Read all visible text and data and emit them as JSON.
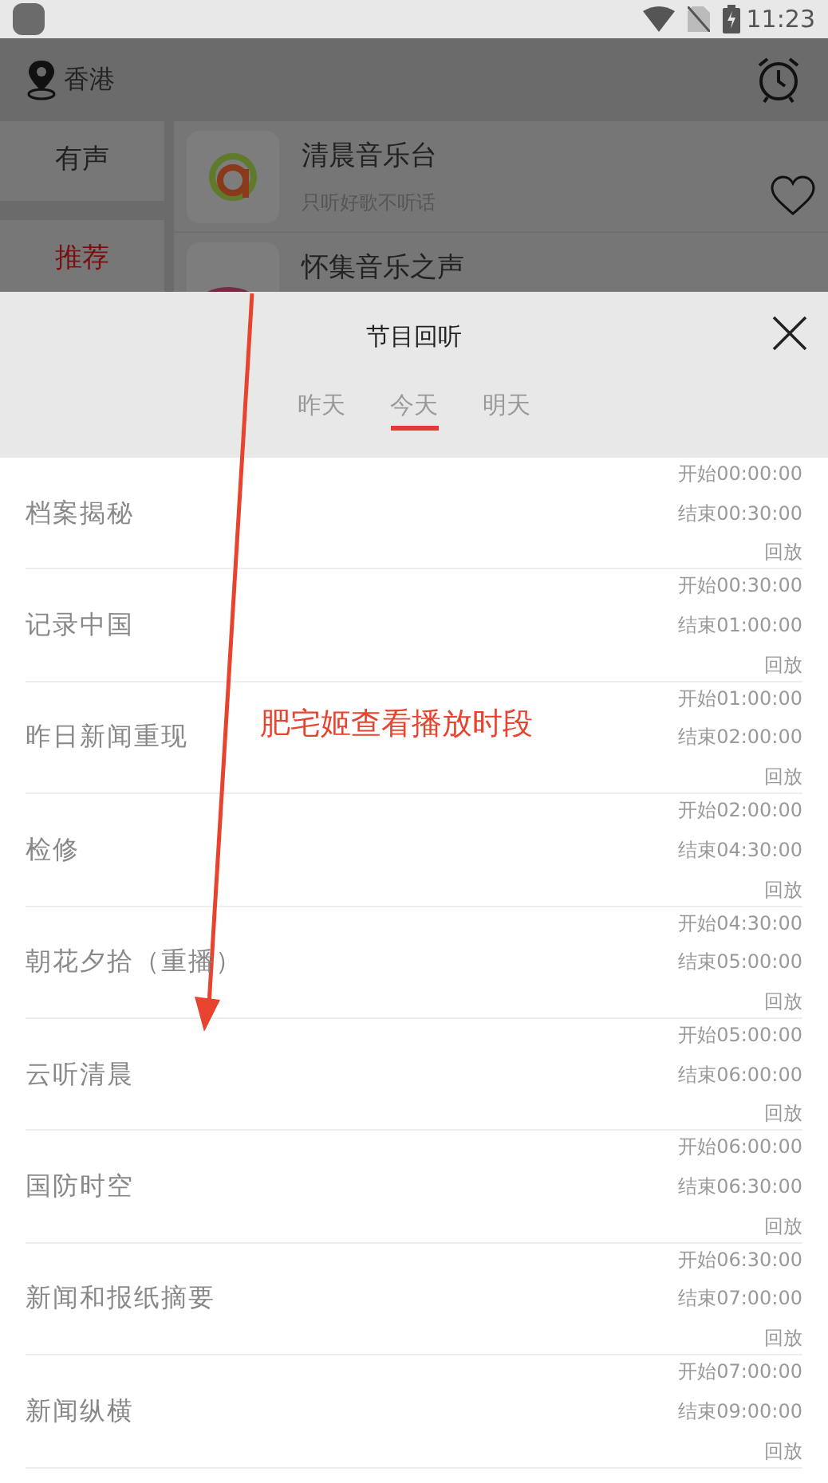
{
  "status_bar": {
    "time": "11:23"
  },
  "header": {
    "location": "香港"
  },
  "categories": [
    {
      "label": "有声",
      "selected": false
    },
    {
      "label": "推荐",
      "selected": true
    }
  ],
  "stations": [
    {
      "name": "清晨音乐台",
      "slogan": "只听好歌不听话"
    },
    {
      "name": "怀集音乐之声"
    }
  ],
  "sheet": {
    "title": "节目回听",
    "tabs": [
      {
        "label": "昨天",
        "selected": false
      },
      {
        "label": "今天",
        "selected": true
      },
      {
        "label": "明天",
        "selected": false
      }
    ],
    "programs": [
      {
        "title": "档案揭秘",
        "start": "开始00:00:00",
        "end": "结束00:30:00",
        "action": "回放"
      },
      {
        "title": "记录中国",
        "start": "开始00:30:00",
        "end": "结束01:00:00",
        "action": "回放"
      },
      {
        "title": "昨日新闻重现",
        "start": "开始01:00:00",
        "end": "结束02:00:00",
        "action": "回放"
      },
      {
        "title": "检修",
        "start": "开始02:00:00",
        "end": "结束04:30:00",
        "action": "回放"
      },
      {
        "title": "朝花夕拾（重播）",
        "start": "开始04:30:00",
        "end": "结束05:00:00",
        "action": "回放"
      },
      {
        "title": "云听清晨",
        "start": "开始05:00:00",
        "end": "结束06:00:00",
        "action": "回放"
      },
      {
        "title": "国防时空",
        "start": "开始06:00:00",
        "end": "结束06:30:00",
        "action": "回放"
      },
      {
        "title": "新闻和报纸摘要",
        "start": "开始06:30:00",
        "end": "结束07:00:00",
        "action": "回放"
      },
      {
        "title": "新闻纵横",
        "start": "开始07:00:00",
        "end": "结束09:00:00",
        "action": "回放"
      }
    ]
  },
  "annotation": {
    "text": "肥宅姬查看播放时段"
  }
}
